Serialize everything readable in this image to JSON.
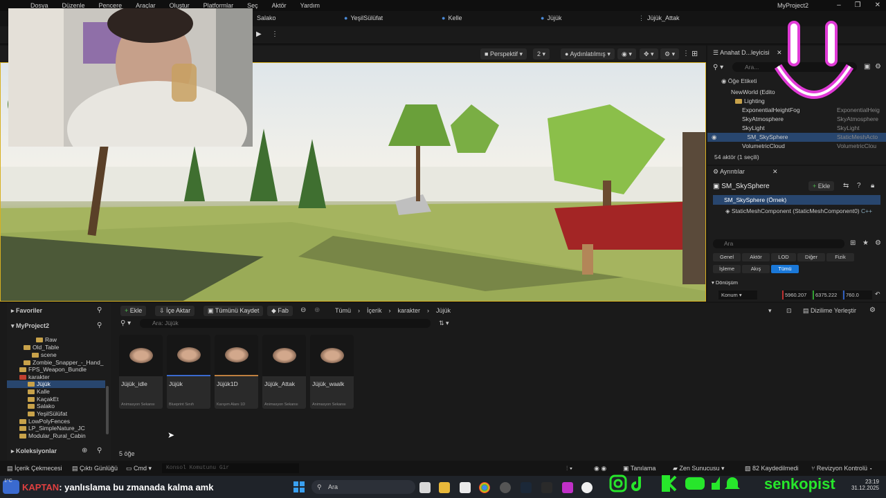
{
  "menu": [
    "Dosya",
    "Düzenle",
    "Pencere",
    "Araçlar",
    "Oluştur",
    "Platformlar",
    "Seç",
    "Aktör",
    "Yardım"
  ],
  "window_title": "MyProject2",
  "level_tabs": [
    "Salako",
    "YeşilSülüfat",
    "Kelle",
    "Jüjük",
    "Jüjük_Attak"
  ],
  "viewport": {
    "perspective": "Perspektif",
    "lit": "Aydınlatılmış",
    "speed": "2"
  },
  "outliner": {
    "tab": "Anahat D...leyicisi",
    "search_placeholder": "Ara...",
    "col_label": "Öğe Etiketi",
    "rows": [
      {
        "name": "NewWorld (Edito",
        "type": ""
      },
      {
        "name": "Lighting",
        "type": ""
      },
      {
        "name": "ExponentialHeightFog",
        "type": "ExponentialHeig"
      },
      {
        "name": "SkyAtmosphere",
        "type": "SkyAtmosphere"
      },
      {
        "name": "SkyLight",
        "type": "SkyLight"
      },
      {
        "name": "SM_SkySphere",
        "type": "StaticMeshActo"
      },
      {
        "name": "VolumetricCloud",
        "type": "VolumetricClou"
      }
    ],
    "footer": "54 aktör (1 seçili)"
  },
  "details": {
    "tab": "Ayrıntılar",
    "object": "SM_SkySphere",
    "add": "Ekle",
    "instance": "SM_SkySphere (Örnek)",
    "component": "StaticMeshComponent (StaticMeshComponent0)",
    "component_lang": "C++",
    "search_placeholder": "Ara",
    "filters_row1": [
      "Genel",
      "Aktör",
      "LOD",
      "Diğer",
      "Fizik"
    ],
    "filters_row2": [
      "İşleme",
      "Akış",
      "Tümü"
    ],
    "section": "Dönüşüm",
    "location_label": "Konum",
    "location": [
      "5960.207",
      "6375.222",
      "760.0"
    ]
  },
  "content_browser": {
    "favorites": "Favoriler",
    "project": "MyProject2",
    "collections": "Koleksiyonlar",
    "add": "Ekle",
    "import": "İçe Aktar",
    "save_all": "Tümünü Kaydet",
    "fab": "Fab",
    "breadcrumb": [
      "Tümü",
      "İçerik",
      "karakter",
      "Jüjük"
    ],
    "dock": "Dizilime Yerleştir",
    "search_placeholder": "Ara: Jüjük",
    "count": "5 öğe",
    "tree": [
      "Raw",
      "Old_Table",
      "scene",
      "Zombie_Snapper_-_Hand_",
      "FPS_Weapon_Bundle",
      "karakter",
      "Jüjük",
      "Kalle",
      "KaçakEt",
      "Salako",
      "YeşilSülüfat",
      "LowPolyFences",
      "LP_SimpleNature_JC",
      "Modular_Rural_Cabin"
    ],
    "assets": [
      {
        "name": "Jüjük_idle",
        "type": "Animasyon Sekansı"
      },
      {
        "name": "Jüjük",
        "type": "Blueprint Sınıfı"
      },
      {
        "name": "Jüjük1D",
        "type": "Karışım Alanı 1D"
      },
      {
        "name": "Jüjük_Attak",
        "type": "Animasyon Sekansı"
      },
      {
        "name": "Jüjük_waalk",
        "type": "Animasyon Sekansı"
      }
    ]
  },
  "status": {
    "drawer": "İçerik Çekmecesi",
    "output": "Çıktı Günlüğü",
    "cmd": "Cmd",
    "console_placeholder": "Konsol Komutunu Gir",
    "derive": "Tanılama",
    "zen": "Zen Sunucusu",
    "saved": "82 Kaydedilmedi",
    "revision": "Revizyon Kontrolü"
  },
  "taskbar": {
    "weather": "1°C",
    "chat_user": "KAPTAN",
    "chat_msg": ": yanlıslama bu zmanada kalma amk",
    "search": "Ara",
    "time": "23:19",
    "date": "31.12.2025",
    "social_name": "senkopist"
  },
  "colors": {
    "accent": "#1a78d8",
    "selection": "#28466e",
    "folder": "#c8a24a",
    "social": "#27e62b",
    "smiley": "#e03ad6"
  }
}
